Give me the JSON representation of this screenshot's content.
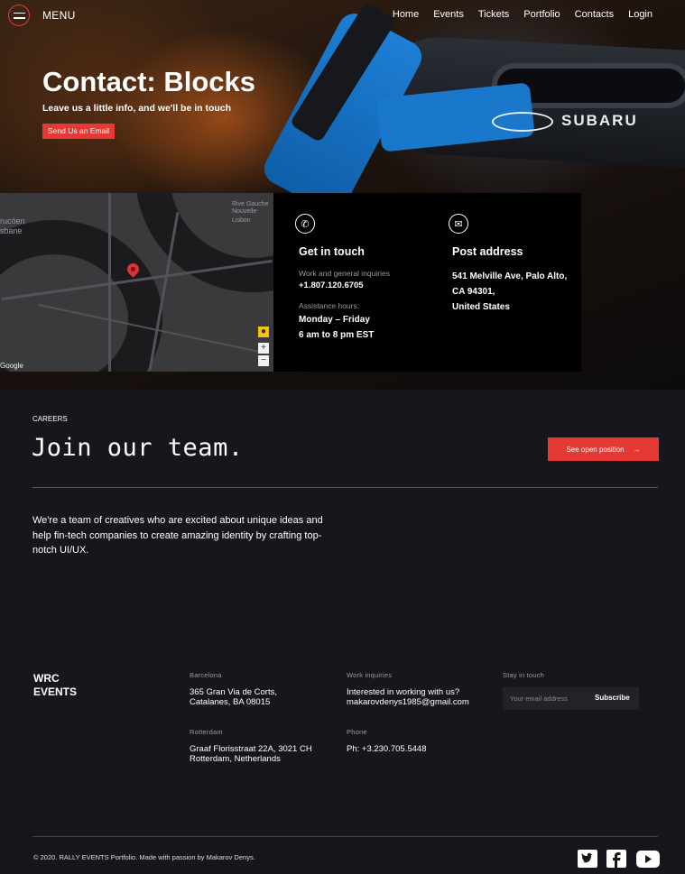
{
  "header": {
    "menu_label": "MENU",
    "nav": [
      "Home",
      "Events",
      "Tickets",
      "Portfolio",
      "Contacts",
      "Login"
    ]
  },
  "hero": {
    "title": "Contact: Blocks",
    "subtitle": "Leave us a little info, and we'll be in touch",
    "button": "Send Us an Email",
    "car_brand": "SUBARU"
  },
  "map": {
    "labels": [
      "Rive Gauche",
      "Nouvelle-Lisbon",
      "rucóen",
      "sbane"
    ],
    "attribution": "Google",
    "zoom_in": "+",
    "zoom_out": "−"
  },
  "get_in_touch": {
    "title": "Get in touch",
    "inquiries_label": "Work and general inquiries",
    "phone": "+1.807.120.6705",
    "hours_label": "Assistance hours:",
    "days": "Monday – Friday",
    "hours": "6 am to 8 pm EST"
  },
  "post_address": {
    "title": "Post address",
    "line1": "541 Melville Ave, Palo Alto,",
    "line2": "CA 94301,",
    "line3": "United States"
  },
  "careers": {
    "tag": "CAREERS",
    "title": "Join our team.",
    "button": "See open position",
    "description": "We're a team of creatives who are excited about unique ideas and help fin-tech companies to create amazing identity by crafting top-notch UI/UX."
  },
  "footer": {
    "logo_line1": "WRC",
    "logo_line2": "EVENTS",
    "barcelona_label": "Barcelona",
    "barcelona_line1": "365 Gran Via de Corts,",
    "barcelona_line2": "Catalanes, BA 08015",
    "rotterdam_label": "Rotterdam",
    "rotterdam_line1": "Graaf Florisstraat 22A, 3021 CH",
    "rotterdam_line2": "Rotterdam, Netherlands",
    "work_label": "Work inquiries",
    "work_line1": "Interested in working with us?",
    "work_email": "makarovdenys1985@gmail.com",
    "phone_label": "Phone",
    "phone": "Ph: +3.230.705.5448",
    "stay_label": "Stay in touch",
    "email_placeholder": "Your email address",
    "subscribe": "Subscribe",
    "copyright": "© 2020. RALLY EVENTS Portfolio. Made with passion by Makarov Denys."
  },
  "colors": {
    "accent": "#e53935",
    "background": "#17161c",
    "panel": "#000000"
  },
  "icons": [
    "menu-icon",
    "phone-icon",
    "mail-icon",
    "map-pin-icon",
    "arrow-right-icon",
    "twitter-icon",
    "facebook-icon",
    "youtube-icon"
  ]
}
